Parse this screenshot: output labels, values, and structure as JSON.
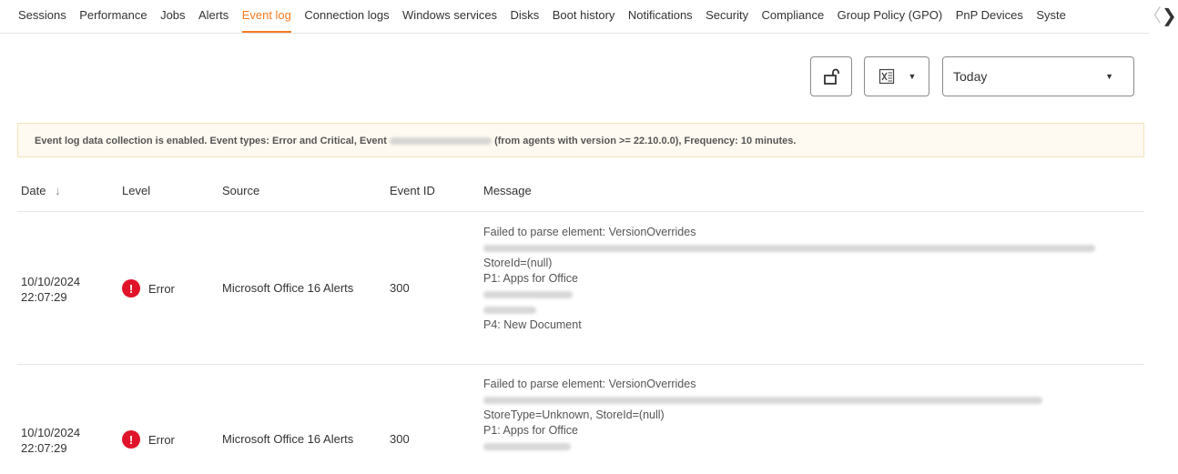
{
  "tabs": {
    "items": [
      {
        "label": "Sessions",
        "active": false
      },
      {
        "label": "Performance",
        "active": false
      },
      {
        "label": "Jobs",
        "active": false
      },
      {
        "label": "Alerts",
        "active": false
      },
      {
        "label": "Event log",
        "active": true
      },
      {
        "label": "Connection logs",
        "active": false
      },
      {
        "label": "Windows services",
        "active": false
      },
      {
        "label": "Disks",
        "active": false
      },
      {
        "label": "Boot history",
        "active": false
      },
      {
        "label": "Notifications",
        "active": false
      },
      {
        "label": "Security",
        "active": false
      },
      {
        "label": "Compliance",
        "active": false
      },
      {
        "label": "Group Policy (GPO)",
        "active": false
      },
      {
        "label": "PnP Devices",
        "active": false
      },
      {
        "label": "Syste",
        "active": false
      }
    ],
    "prev_icon": "chevron-left-icon",
    "next_icon": "chevron-right-icon",
    "prev_glyph": "〈",
    "next_glyph": "❯"
  },
  "toolbar": {
    "unlock_icon": "unlock-icon",
    "excel_icon": "excel-export-icon",
    "caret_glyph": "▼",
    "date_range": "Today"
  },
  "notice": {
    "text_before": "Event log data collection is enabled. Event types: Error and Critical, Event",
    "text_after": "(from agents with version >= 22.10.0.0), Frequency: 10 minutes."
  },
  "table": {
    "headers": {
      "date": "Date",
      "sort_glyph": "↓",
      "level": "Level",
      "source": "Source",
      "event_id": "Event ID",
      "message": "Message"
    },
    "rows": [
      {
        "date": "10/10/2024",
        "time": "22:07:29",
        "level": "Error",
        "level_glyph": "!",
        "source": "Microsoft Office 16 Alerts",
        "event_id": "300",
        "message": {
          "line1": "Failed to parse element: VersionOverrides",
          "line3": "StoreId=(null)",
          "line4": "P1: Apps for Office",
          "line7": "P4: New Document"
        }
      },
      {
        "date": "10/10/2024",
        "time": "22:07:29",
        "level": "Error",
        "level_glyph": "!",
        "source": "Microsoft Office 16 Alerts",
        "event_id": "300",
        "message": {
          "line1": "Failed to parse element: VersionOverrides",
          "line3": "StoreType=Unknown, StoreId=(null)",
          "line4": "P1: Apps for Office"
        }
      }
    ]
  },
  "colors": {
    "accent": "#f47b20",
    "error": "#e0132a",
    "notice_bg": "#fffaf1",
    "notice_border": "#f6e3bb"
  }
}
